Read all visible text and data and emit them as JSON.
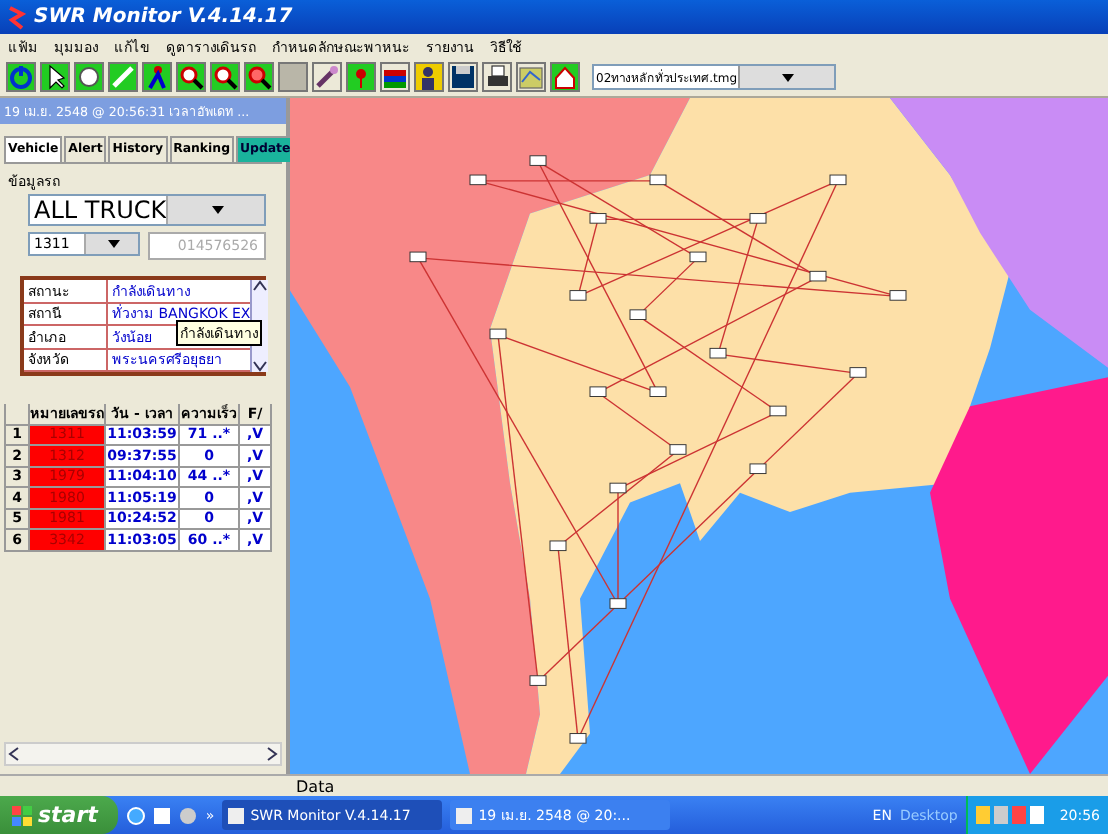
{
  "window": {
    "title": "SWR Monitor V.4.14.17"
  },
  "menu": [
    "แฟ้ม",
    "มุมมอง",
    "แก้ไข",
    "ดูตารางเดินรถ",
    "กำหนดลักษณะพาหนะ",
    "รายงาน",
    "วิธีใช้"
  ],
  "map_selector": {
    "value": "02ทางหลักทั่วประเทศ.tmg"
  },
  "panel": {
    "header": "19 เม.ย. 2548 @  20:56:31 เวลาอัพเดท ...",
    "tabs": [
      {
        "label": "Vehicle",
        "selected": true,
        "kind": "tab"
      },
      {
        "label": "Alert",
        "selected": false,
        "kind": "tab"
      },
      {
        "label": "History",
        "selected": false,
        "kind": "tab"
      },
      {
        "label": "Ranking",
        "selected": false,
        "kind": "tab"
      },
      {
        "label": "Update",
        "selected": false,
        "kind": "action"
      }
    ],
    "group_label": "ข้อมูลรถ",
    "fleet": "ALL TRUCK",
    "vehicle": "1311",
    "phone": "014576526",
    "info": [
      {
        "label": "สถานะ",
        "value": "กำลังเดินทาง"
      },
      {
        "label": "สถานี",
        "value": "ทั่วงาม BANGKOK EX"
      },
      {
        "label": "อำเภอ",
        "value": "วังน้อย"
      },
      {
        "label": "จังหวัด",
        "value": "พระนครศรีอยุธยา"
      }
    ],
    "tooltip": "กำลังเดินทาง",
    "columns": [
      "หมายเลขรถ",
      "วัน - เวลา",
      "ความเร็ว",
      "F/"
    ],
    "rows": [
      {
        "index": "1",
        "plate": "1311",
        "time": "11:03:59",
        "speed": "71 ..*",
        "flag": ",V"
      },
      {
        "index": "2",
        "plate": "1312",
        "time": "09:37:55",
        "speed": "0",
        "flag": ",V"
      },
      {
        "index": "3",
        "plate": "1979",
        "time": "11:04:10",
        "speed": "44 ..*",
        "flag": ",V"
      },
      {
        "index": "4",
        "plate": "1980",
        "time": "11:05:19",
        "speed": "0",
        "flag": ",V"
      },
      {
        "index": "5",
        "plate": "1981",
        "time": "10:24:52",
        "speed": "0",
        "flag": ",V"
      },
      {
        "index": "6",
        "plate": "3342",
        "time": "11:03:05",
        "speed": "60 ..*",
        "flag": ",V"
      }
    ]
  },
  "status_bar": "Data",
  "taskbar": {
    "start": "start",
    "tasks": [
      {
        "label": "SWR Monitor V.4.14.17",
        "selected": true
      },
      {
        "label": "19 เม.ย. 2548 @  20:...",
        "selected": false
      }
    ],
    "language": "EN",
    "desktop": "Desktop",
    "chevron": "»",
    "clock": "20:56"
  }
}
